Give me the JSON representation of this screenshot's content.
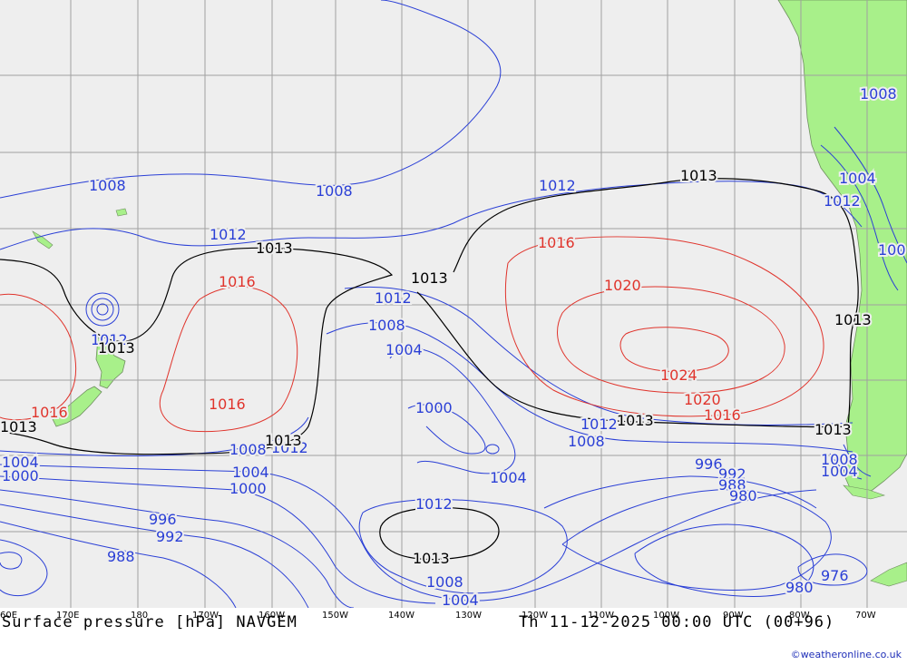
{
  "map": {
    "title": "Surface pressure [hPa] NAVGEM",
    "valid_time": "Th 11-12-2025 00:00 UTC (00+96)",
    "credit": "©weatheronline.co.uk",
    "colors": {
      "ocean": "#eeeeee",
      "land": "#a8f08a",
      "grid": "#a0a0a0",
      "isobar_low": "#2a3fd6",
      "isobar_high": "#e0342c",
      "isobar_1013": "#000000"
    },
    "longitude_labels": [
      "60E",
      "170E",
      "180",
      "170W",
      "160W",
      "150W",
      "140W",
      "130W",
      "120W",
      "110W",
      "100W",
      "90W",
      "80W",
      "70W"
    ],
    "pressure_labels": {
      "blue": [
        "1008",
        "1008",
        "1012",
        "1012",
        "1008",
        "1004",
        "1000",
        "1004",
        "1012",
        "1008",
        "1004",
        "1000",
        "996",
        "992",
        "988",
        "1012",
        "1008",
        "1004",
        "1008",
        "1004",
        "1012",
        "1012",
        "1008",
        "1004",
        "996",
        "992",
        "988",
        "980",
        "976",
        "980",
        "1008",
        "1004",
        "1004",
        "1000",
        "1012",
        "1012",
        "1008",
        "1004",
        "100"
      ],
      "red": [
        "1016",
        "1016",
        "1016",
        "1016",
        "1020",
        "1024",
        "1020",
        "1016"
      ],
      "black": [
        "1013",
        "1013",
        "1013",
        "1013",
        "1013",
        "1013",
        "1013",
        "1013",
        "1013"
      ]
    }
  }
}
